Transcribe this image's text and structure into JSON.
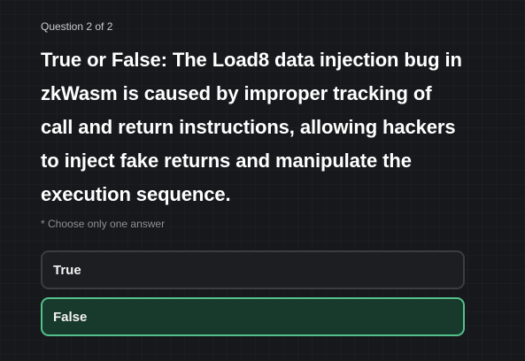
{
  "quiz": {
    "counter": "Question 2 of 2",
    "question": "True or False: The Load8 data injection bug in zkWasm is caused by improper tracking of call and return instructions, allowing hackers to inject fake returns and manipulate the execution sequence.",
    "hint": "* Choose only one answer",
    "options": [
      {
        "label": "True",
        "selected": false
      },
      {
        "label": "False",
        "selected": true
      }
    ]
  },
  "colors": {
    "background": "#16181b",
    "option_border": "#3a3d42",
    "selected_border": "#54c08c",
    "selected_fill": "#183a2c"
  }
}
